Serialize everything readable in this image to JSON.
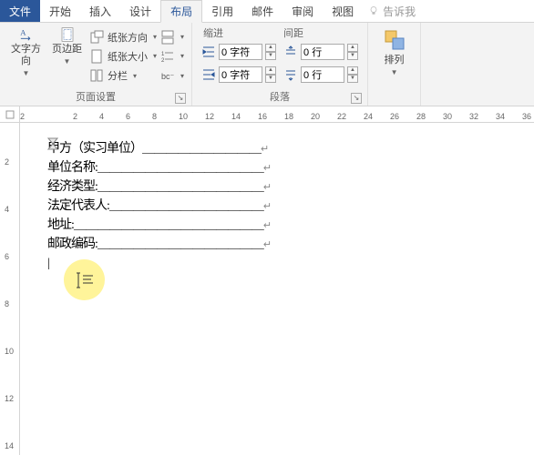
{
  "tabs": {
    "file": "文件",
    "home": "开始",
    "insert": "插入",
    "design": "设计",
    "layout": "布局",
    "references": "引用",
    "mailings": "邮件",
    "review": "审阅",
    "view": "视图",
    "tellme": "告诉我"
  },
  "ribbon": {
    "page_setup": {
      "text_direction": "文字方向",
      "margins": "页边距",
      "orientation": "纸张方向",
      "size": "纸张大小",
      "columns": "分栏",
      "label": "页面设置"
    },
    "paragraph": {
      "indent_label": "缩进",
      "spacing_label": "间距",
      "left_value": "0 字符",
      "right_value": "0 字符",
      "before_value": "0 行",
      "after_value": "0 行",
      "label": "段落"
    },
    "arrange": {
      "label": "排列"
    }
  },
  "ruler_h": [
    "2",
    "",
    "2",
    "4",
    "6",
    "8",
    "10",
    "12",
    "14",
    "16",
    "18",
    "20",
    "22",
    "24",
    "26",
    "28",
    "30",
    "32",
    "34",
    "36"
  ],
  "ruler_v": [
    "",
    "2",
    "",
    "4",
    "",
    "6",
    "",
    "8",
    "",
    "10",
    "",
    "12",
    "",
    "14"
  ],
  "document": {
    "lines": [
      "甲方（实习单位）＿＿＿＿＿＿＿＿＿＿",
      "单位名称:＿＿＿＿＿＿＿＿＿＿＿＿＿＿",
      "经济类型:＿＿＿＿＿＿＿＿＿＿＿＿＿＿",
      "法定代表人:＿＿＿＿＿＿＿＿＿＿＿＿＿",
      "地址:＿＿＿＿＿＿＿＿＿＿＿＿＿＿＿＿",
      "邮政编码:＿＿＿＿＿＿＿＿＿＿＿＿＿＿"
    ]
  }
}
